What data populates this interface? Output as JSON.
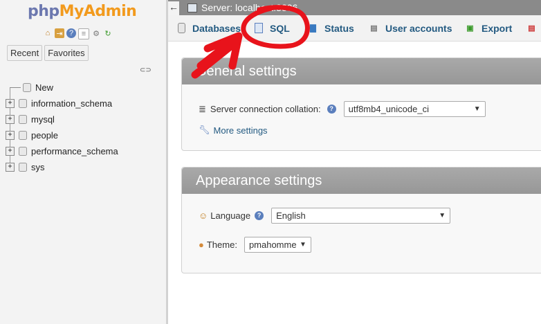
{
  "sidebar": {
    "logo_php": "php",
    "logo_myadmin": "MyAdmin",
    "quick_icons": [
      "home-icon",
      "logout-icon",
      "help-icon",
      "docs-icon",
      "settings-icon",
      "reload-icon"
    ],
    "tabs": [
      "Recent",
      "Favorites"
    ],
    "tree": [
      {
        "label": "New",
        "expandable": false
      },
      {
        "label": "information_schema",
        "expandable": true
      },
      {
        "label": "mysql",
        "expandable": true
      },
      {
        "label": "people",
        "expandable": true
      },
      {
        "label": "performance_schema",
        "expandable": true
      },
      {
        "label": "sys",
        "expandable": true
      }
    ]
  },
  "topbar": {
    "back": "←",
    "server_label": "Server: localhost:3306"
  },
  "tabs": [
    {
      "label": "Databases",
      "icon": "database-icon"
    },
    {
      "label": "SQL",
      "icon": "sql-icon"
    },
    {
      "label": "Status",
      "icon": "status-icon"
    },
    {
      "label": "User accounts",
      "icon": "users-icon"
    },
    {
      "label": "Export",
      "icon": "export-icon"
    }
  ],
  "general": {
    "title": "General settings",
    "collation_label": "Server connection collation:",
    "collation_value": "utf8mb4_unicode_ci",
    "more_settings": "More settings"
  },
  "appearance": {
    "title": "Appearance settings",
    "language_label": "Language",
    "language_value": "English",
    "theme_label": "Theme:",
    "theme_value": "pmahomme"
  },
  "colors": {
    "annotation": "#e8131b",
    "link": "#235a81",
    "logo_php": "#6c78af",
    "logo_admin": "#f29a1d"
  }
}
